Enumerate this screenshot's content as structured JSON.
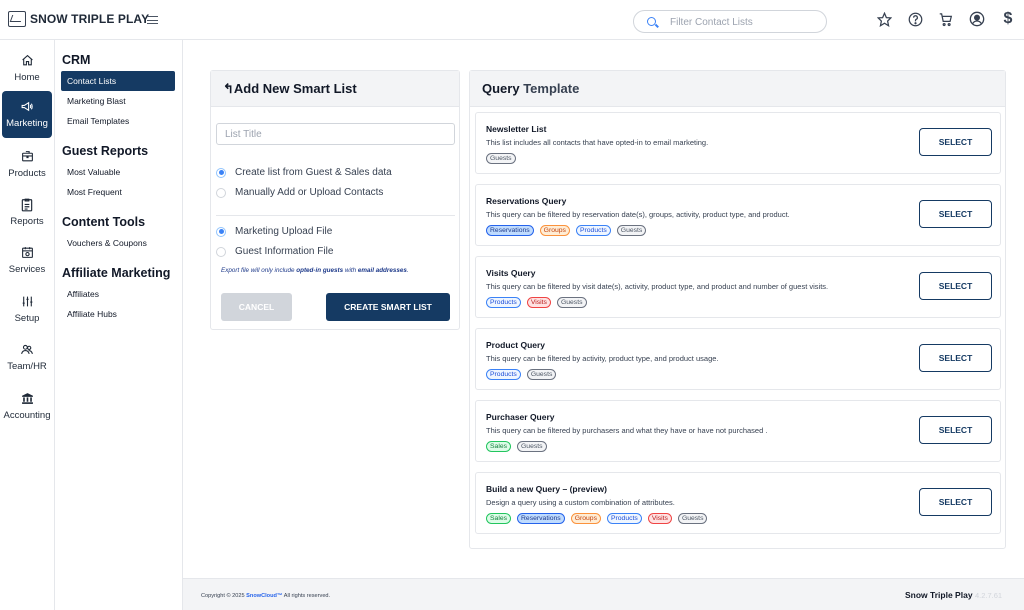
{
  "header": {
    "brand": "SNOW TRIPLE PLAY",
    "search_placeholder": "Filter Contact Lists",
    "icons": [
      "star-icon",
      "help-icon",
      "cart-icon",
      "user-icon",
      "dollar-icon"
    ]
  },
  "rail": [
    {
      "label": "Home",
      "icon": "home-icon"
    },
    {
      "label": "Marketing",
      "icon": "megaphone-icon",
      "active": true
    },
    {
      "label": "Products",
      "icon": "products-icon"
    },
    {
      "label": "Reports",
      "icon": "reports-icon"
    },
    {
      "label": "Services",
      "icon": "services-icon"
    },
    {
      "label": "Setup",
      "icon": "setup-icon"
    },
    {
      "label": "Team/HR",
      "icon": "team-icon"
    },
    {
      "label": "Accounting",
      "icon": "bank-icon"
    }
  ],
  "subnav": {
    "sections": [
      {
        "title": "CRM",
        "links": [
          "Contact Lists",
          "Marketing Blast",
          "Email Templates"
        ]
      },
      {
        "title": "Guest Reports",
        "links": [
          "Most Valuable",
          "Most Frequent"
        ]
      },
      {
        "title": "Content Tools",
        "links": [
          "Vouchers & Coupons"
        ]
      },
      {
        "title": "Affiliate Marketing",
        "links": [
          "Affiliates",
          "Affiliate Hubs"
        ]
      }
    ],
    "active_link": "Contact Lists"
  },
  "smart_list": {
    "title": "Add New Smart List",
    "list_title_placeholder": "List Title",
    "source_options": [
      "Create list from Guest & Sales data",
      "Manually Add or Upload Contacts"
    ],
    "source_selected": "Create list from Guest & Sales data",
    "file_options": [
      "Marketing Upload File",
      "Guest Information File"
    ],
    "file_selected": "Marketing Upload File",
    "hint_prefix": "Export file will only include ",
    "hint_emph1": "opted-in guests",
    "hint_mid": " with ",
    "hint_emph2": "email addresses",
    "hint_suffix": ".",
    "cancel_label": "CANCEL",
    "create_label": "CREATE SMART LIST"
  },
  "query_template": {
    "title_bold": "Query",
    "title_rest": " Template",
    "select_label": "SELECT",
    "queries": [
      {
        "name": "Newsletter List",
        "desc": "This list includes all contacts that have opted-in to email marketing.",
        "tags": [
          "Guests"
        ]
      },
      {
        "name": "Reservations Query",
        "desc": "This query can be filtered by reservation date(s), groups, activity, product type, and product.",
        "tags": [
          "Reservations",
          "Groups",
          "Products",
          "Guests"
        ]
      },
      {
        "name": "Visits Query",
        "desc": "This query can be filtered by visit date(s), activity, product type, and product and number of guest visits.",
        "tags": [
          "Products",
          "Visits",
          "Guests"
        ]
      },
      {
        "name": "Product Query",
        "desc": "This query can be filtered by activity, product type, and product usage.",
        "tags": [
          "Products",
          "Guests"
        ]
      },
      {
        "name": "Purchaser Query",
        "desc": "This query can be filtered by purchasers and what they have or have not purchased .",
        "tags": [
          "Sales",
          "Guests"
        ]
      },
      {
        "name": "Build a new Query – (preview)",
        "desc": "Design a query using a custom combination of attributes.",
        "tags": [
          "Sales",
          "Reservations",
          "Groups",
          "Products",
          "Visits",
          "Guests"
        ]
      }
    ],
    "tag_colors": {
      "Guests": {
        "bg": "#f3f4f6",
        "border": "#6b7280",
        "text": "#4b5563"
      },
      "Reservations": {
        "bg": "#bfdbfe",
        "border": "#2563eb",
        "text": "#1e3a8a"
      },
      "Groups": {
        "bg": "#ffedd5",
        "border": "#fb923c",
        "text": "#c2410c"
      },
      "Products": {
        "bg": "#eff6ff",
        "border": "#3b82f6",
        "text": "#1d4ed8"
      },
      "Visits": {
        "bg": "#fee2e2",
        "border": "#ef4444",
        "text": "#b91c1c"
      },
      "Sales": {
        "bg": "#dcfce7",
        "border": "#22c55e",
        "text": "#15803d"
      }
    }
  },
  "footer": {
    "copyright_prefix": "Copyright © 2025 ",
    "copyright_brand": "SnowCloud™",
    "copyright_suffix": " All rights reserved.",
    "brand": "Snow Triple Play",
    "version": "4.2.7.61"
  }
}
